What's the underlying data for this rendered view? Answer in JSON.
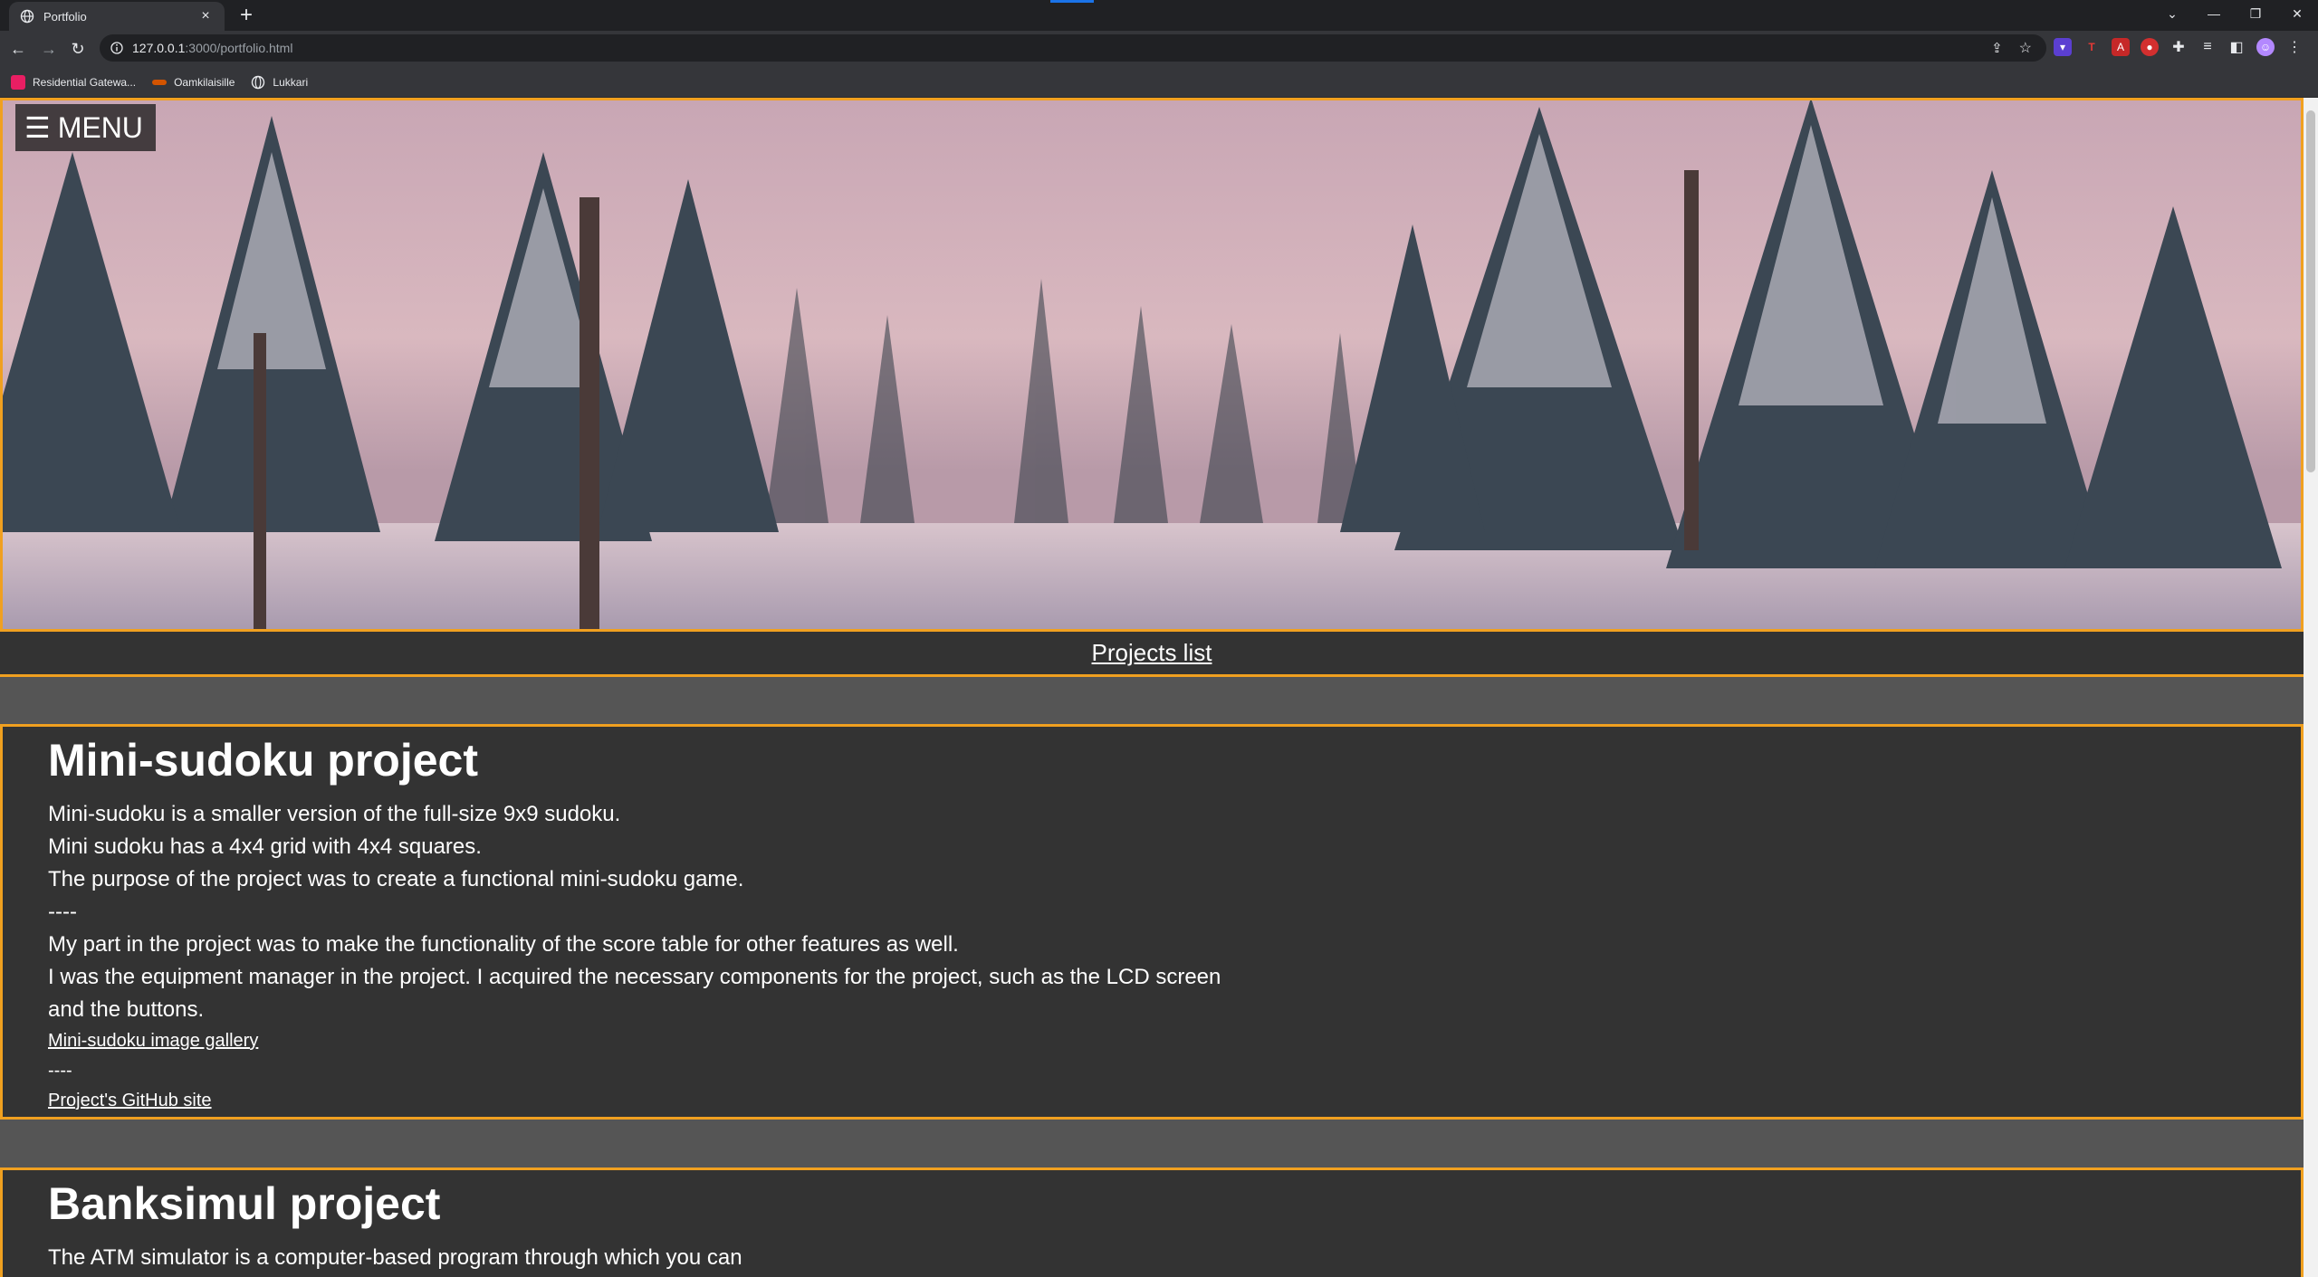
{
  "browser": {
    "tab_title": "Portfolio",
    "url_host": "127.0.0.1",
    "url_path": ":3000/portfolio.html",
    "bookmarks": [
      {
        "label": "Residential Gatewa...",
        "color": "#e91e63"
      },
      {
        "label": "Oamkilaisille",
        "color": "#d35400"
      },
      {
        "label": "Lukkari",
        "color": "#9aa0a6"
      }
    ]
  },
  "page": {
    "menu_label": "MENU",
    "projects_link": "Projects list",
    "colors": {
      "accent": "#f0a020",
      "panel": "#333333",
      "background": "#555555"
    },
    "projects": [
      {
        "title": "Mini-sudoku project",
        "lines": [
          "Mini-sudoku is a smaller version of the full-size 9x9 sudoku.",
          "Mini sudoku has a 4x4 grid with 4x4 squares.",
          "The purpose of the project was to create a functional mini-sudoku game.",
          "----",
          "My part in the project was to make the functionality of the score table for other features as well.",
          "I was the equipment manager in the project. I acquired the necessary components for the project, such as the LCD screen and the buttons."
        ],
        "gallery_link": "Mini-sudoku image gallery",
        "separator": "----",
        "github_link": "Project's GitHub site"
      },
      {
        "title": "Banksimul project",
        "lines": [
          "The ATM simulator is a computer-based program through which you can"
        ]
      }
    ]
  }
}
